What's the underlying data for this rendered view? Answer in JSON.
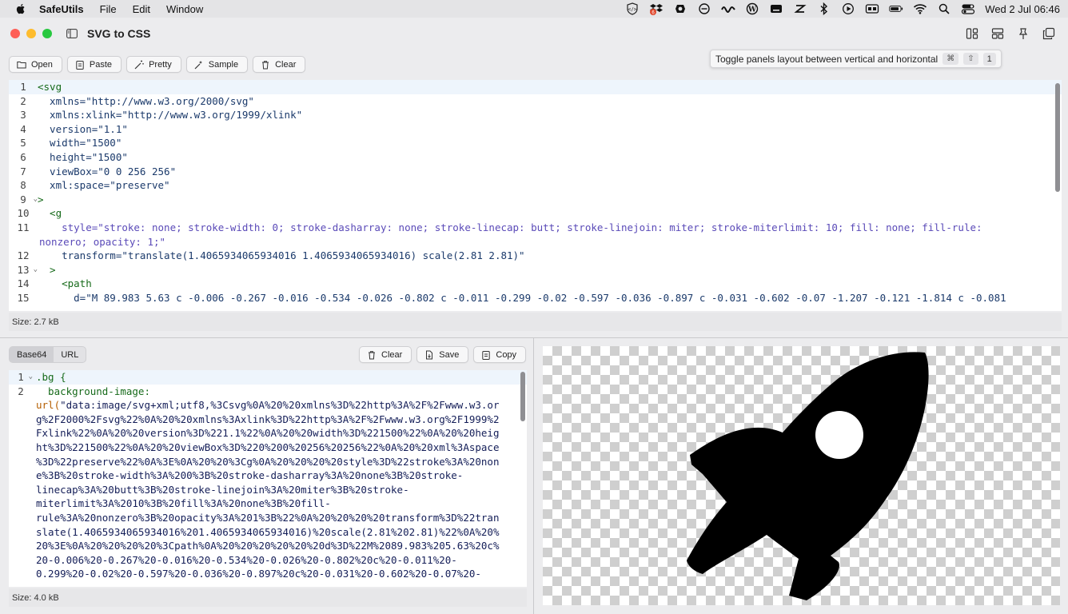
{
  "menubar": {
    "app_name": "SafeUtils",
    "menus": [
      "File",
      "Edit",
      "Window"
    ],
    "clock": "Wed 2 Jul  06:46"
  },
  "window": {
    "title": "SVG to CSS"
  },
  "toolbar": {
    "open": "Open",
    "paste": "Paste",
    "pretty": "Pretty",
    "sample": "Sample",
    "clear": "Clear"
  },
  "tooltip": {
    "text": "Toggle panels layout between vertical and horizontal",
    "keys": [
      "⌘",
      "⇧",
      "1"
    ]
  },
  "input_editor": {
    "lines": [
      {
        "n": "1",
        "text": "<svg"
      },
      {
        "n": "2",
        "text": "  xmlns=\"http://www.w3.org/2000/svg\""
      },
      {
        "n": "3",
        "text": "  xmlns:xlink=\"http://www.w3.org/1999/xlink\""
      },
      {
        "n": "4",
        "text": "  version=\"1.1\""
      },
      {
        "n": "5",
        "text": "  width=\"1500\""
      },
      {
        "n": "6",
        "text": "  height=\"1500\""
      },
      {
        "n": "7",
        "text": "  viewBox=\"0 0 256 256\""
      },
      {
        "n": "8",
        "text": "  xml:space=\"preserve\""
      },
      {
        "n": "9",
        "text": ">"
      },
      {
        "n": "10",
        "text": "  <g"
      },
      {
        "n": "11",
        "text": "    style=\"stroke: none; stroke-width: 0; stroke-dasharray: none; stroke-linecap: butt; stroke-linejoin: miter; stroke-miterlimit: 10; fill: none; fill-rule:"
      },
      {
        "n": "",
        "text": "nonzero; opacity: 1;\""
      },
      {
        "n": "12",
        "text": "    transform=\"translate(1.4065934065934016 1.4065934065934016) scale(2.81 2.81)\""
      },
      {
        "n": "13",
        "text": "  >"
      },
      {
        "n": "14",
        "text": "    <path"
      },
      {
        "n": "15",
        "text": "      d=\"M 89.983 5.63 c -0.006 -0.267 -0.016 -0.534 -0.026 -0.802 c -0.011 -0.299 -0.02 -0.597 -0.036 -0.897 c -0.031 -0.602 -0.07 -1.207 -0.121 -1.814 c -0.081"
      }
    ],
    "size": "Size: 2.7 kB"
  },
  "output_tabs": [
    "Base64",
    "URL"
  ],
  "output_tools": {
    "clear": "Clear",
    "save": "Save",
    "copy": "Copy"
  },
  "output_editor": {
    "line1": ".bg {",
    "line2": "  background-image:",
    "url_kw": "url(",
    "url_body": "\"data:image/svg+xml;utf8,%3Csvg%0A%20%20xmlns%3D%22http%3A%2F%2Fwww.w3.or\ng%2F2000%2Fsvg%22%0A%20%20xmlns%3Axlink%3D%22http%3A%2F%2Fwww.w3.org%2F1999%2\nFxlink%22%0A%20%20version%3D%221.1%22%0A%20%20width%3D%221500%22%0A%20%20heig\nht%3D%221500%22%0A%20%20viewBox%3D%220%200%20256%20256%22%0A%20%20xml%3Aspace\n%3D%22preserve%22%0A%3E%0A%20%20%3Cg%0A%20%20%20%20style%3D%22stroke%3A%20non\ne%3B%20stroke-width%3A%200%3B%20stroke-dasharray%3A%20none%3B%20stroke-\nlinecap%3A%20butt%3B%20stroke-linejoin%3A%20miter%3B%20stroke-\nmiterlimit%3A%2010%3B%20fill%3A%20none%3B%20fill-\nrule%3A%20nonzero%3B%20opacity%3A%201%3B%22%0A%20%20%20%20transform%3D%22tran\nslate(1.4065934065934016%201.4065934065934016)%20scale(2.81%202.81)%22%0A%20%\n20%3E%0A%20%20%20%20%3Cpath%0A%20%20%20%20%20%20d%3D%22M%2089.983%205.63%20c%\n20-0.006%20-0.267%20-0.016%20-0.534%20-0.026%20-0.802%20c%20-0.011%20-\n0.299%20-0.02%20-0.597%20-0.036%20-0.897%20c%20-0.031%20-0.602%20-0.07%20-",
    "size": "Size: 4.0 kB"
  },
  "colors": {
    "accent_red": "#fe5f57",
    "accent_yellow": "#febc2e",
    "accent_green": "#28c840"
  }
}
